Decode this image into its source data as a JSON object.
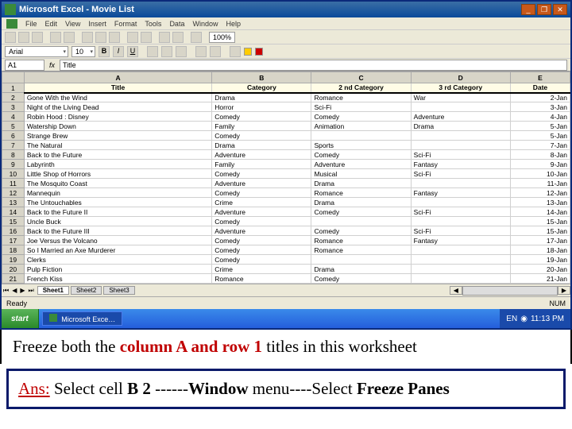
{
  "app": {
    "title": "Microsoft Excel - Movie List"
  },
  "win_buttons": {
    "min": "_",
    "max": "❐",
    "close": "✕"
  },
  "menu": [
    "File",
    "Edit",
    "View",
    "Insert",
    "Format",
    "Tools",
    "Data",
    "Window",
    "Help"
  ],
  "zoom": "100%",
  "font": {
    "name": "Arial",
    "size": "10"
  },
  "formula": {
    "cell": "A1",
    "value": "Title"
  },
  "columns": [
    "",
    "A",
    "B",
    "C",
    "D",
    "E"
  ],
  "col_widths": [
    "20px",
    "170px",
    "90px",
    "90px",
    "90px",
    "54px"
  ],
  "headers": {
    "r": "1",
    "c": [
      "Title",
      "Category",
      "2 nd Category",
      "3 rd Category",
      "Date"
    ]
  },
  "rows": [
    {
      "r": "2",
      "c": [
        "Gone With the Wind",
        "Drama",
        "Romance",
        "War",
        "2-Jan"
      ]
    },
    {
      "r": "3",
      "c": [
        "Night of the Living Dead",
        "Horror",
        "Sci-Fi",
        "",
        "3-Jan"
      ]
    },
    {
      "r": "4",
      "c": [
        "Robin Hood : Disney",
        "Comedy",
        "Comedy",
        "Adventure",
        "4-Jan"
      ]
    },
    {
      "r": "5",
      "c": [
        "Watership Down",
        "Family",
        "Animation",
        "Drama",
        "5-Jan"
      ]
    },
    {
      "r": "6",
      "c": [
        "Strange Brew",
        "Comedy",
        "",
        "",
        "5-Jan"
      ]
    },
    {
      "r": "7",
      "c": [
        "The Natural",
        "Drama",
        "Sports",
        "",
        "7-Jan"
      ]
    },
    {
      "r": "8",
      "c": [
        "Back to the Future",
        "Adventure",
        "Comedy",
        "Sci-Fi",
        "8-Jan"
      ]
    },
    {
      "r": "9",
      "c": [
        "Labyrinth",
        "Family",
        "Adventure",
        "Fantasy",
        "9-Jan"
      ]
    },
    {
      "r": "10",
      "c": [
        "Little Shop of Horrors",
        "Comedy",
        "Musical",
        "Sci-Fi",
        "10-Jan"
      ]
    },
    {
      "r": "11",
      "c": [
        "The Mosquito Coast",
        "Adventure",
        "Drama",
        "",
        "11-Jan"
      ]
    },
    {
      "r": "12",
      "c": [
        "Mannequin",
        "Comedy",
        "Romance",
        "Fantasy",
        "12-Jan"
      ]
    },
    {
      "r": "13",
      "c": [
        "The Untouchables",
        "Crime",
        "Drama",
        "",
        "13-Jan"
      ]
    },
    {
      "r": "14",
      "c": [
        "Back to the Future II",
        "Adventure",
        "Comedy",
        "Sci-Fi",
        "14-Jan"
      ]
    },
    {
      "r": "15",
      "c": [
        "Uncle Buck",
        "Comedy",
        "",
        "",
        "15-Jan"
      ]
    },
    {
      "r": "16",
      "c": [
        "Back to the Future III",
        "Adventure",
        "Comedy",
        "Sci-Fi",
        "15-Jan"
      ]
    },
    {
      "r": "17",
      "c": [
        "Joe Versus the Volcano",
        "Comedy",
        "Romance",
        "Fantasy",
        "17-Jan"
      ]
    },
    {
      "r": "18",
      "c": [
        "So I Married an Axe Murderer",
        "Comedy",
        "Romance",
        "",
        "18-Jan"
      ]
    },
    {
      "r": "19",
      "c": [
        "Clerks",
        "Comedy",
        "",
        "",
        "19-Jan"
      ]
    },
    {
      "r": "20",
      "c": [
        "Pulp Fiction",
        "Crime",
        "Drama",
        "",
        "20-Jan"
      ]
    },
    {
      "r": "21",
      "c": [
        "French Kiss",
        "Romance",
        "Comedy",
        "",
        "21-Jan"
      ]
    }
  ],
  "sheets": [
    "Sheet1",
    "Sheet2",
    "Sheet3"
  ],
  "status": {
    "ready": "Ready",
    "num": "NUM"
  },
  "taskbar": {
    "start": "start",
    "task": "Microsoft Exce…",
    "lang": "EN",
    "time": "11:13 PM"
  },
  "question": {
    "p1": "Freeze both the ",
    "h1": "column A and row 1 ",
    "p2": "titles in this worksheet"
  },
  "answer": {
    "label": "Ans:",
    "p1": " Select cell ",
    "b1": "B 2",
    "p2": " ------",
    "b2": "Window",
    "p3": " menu----Select ",
    "b3": "Freeze Panes"
  }
}
